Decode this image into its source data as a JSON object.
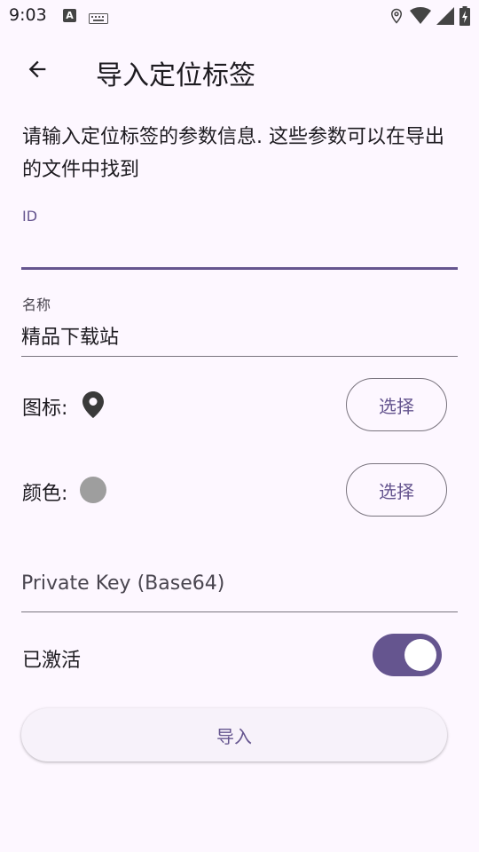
{
  "status_bar": {
    "time": "9:03",
    "icons": [
      "a-icon",
      "keyboard-icon",
      "location-icon",
      "wifi-icon",
      "signal-icon",
      "battery-charging-icon"
    ]
  },
  "app_bar": {
    "back_icon": "arrow-left-icon",
    "title": "导入定位标签"
  },
  "description": "请输入定位标签的参数信息. 这些参数可以在导出的文件中找到",
  "id_field": {
    "label": "ID",
    "value": ""
  },
  "name_field": {
    "label": "名称",
    "value": "精品下载站"
  },
  "icon_row": {
    "label": "图标:",
    "icon": "location-pin-icon",
    "button_label": "选择"
  },
  "color_row": {
    "label": "颜色:",
    "color": "#9e9e9e",
    "button_label": "选择"
  },
  "private_key_field": {
    "placeholder": "Private Key (Base64)",
    "value": ""
  },
  "activated_row": {
    "label": "已激活",
    "checked": true
  },
  "import_button": {
    "label": "导入"
  },
  "colors": {
    "accent": "#65558f",
    "background": "#fdf7ff"
  }
}
